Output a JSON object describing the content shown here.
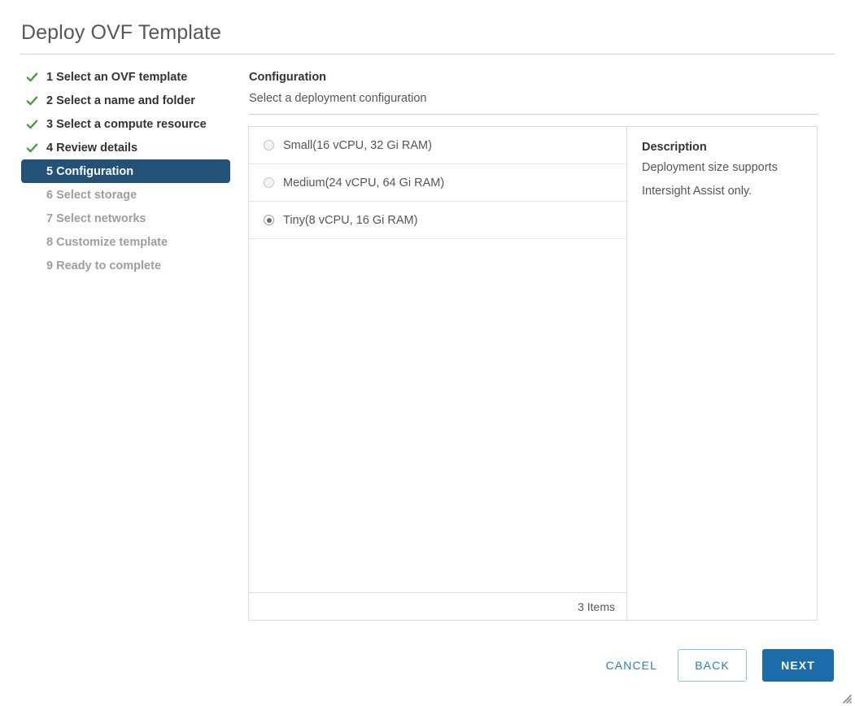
{
  "window": {
    "title": "Deploy OVF Template"
  },
  "steps": [
    {
      "label": "1 Select an OVF template",
      "state": "completed"
    },
    {
      "label": "2 Select a name and folder",
      "state": "completed"
    },
    {
      "label": "3 Select a compute resource",
      "state": "completed"
    },
    {
      "label": "4 Review details",
      "state": "completed"
    },
    {
      "label": "5 Configuration",
      "state": "active"
    },
    {
      "label": "6 Select storage",
      "state": "pending"
    },
    {
      "label": "7 Select networks",
      "state": "pending"
    },
    {
      "label": "8 Customize template",
      "state": "pending"
    },
    {
      "label": "9 Ready to complete",
      "state": "pending"
    }
  ],
  "content": {
    "title": "Configuration",
    "subtitle": "Select a deployment configuration"
  },
  "options": [
    {
      "label": "Small(16 vCPU, 32 Gi RAM)",
      "selected": false
    },
    {
      "label": "Medium(24 vCPU, 64 Gi RAM)",
      "selected": false
    },
    {
      "label": "Tiny(8 vCPU, 16 Gi RAM)",
      "selected": true
    }
  ],
  "options_footer": {
    "item_count": "3 Items"
  },
  "description": {
    "title": "Description",
    "line1": "Deployment size supports",
    "line2": "Intersight Assist only."
  },
  "buttons": {
    "cancel": "CANCEL",
    "back": "BACK",
    "next": "NEXT"
  },
  "colors": {
    "active_step_bg": "#245178",
    "check_green": "#3f9c35",
    "link_blue": "#2d7fb8",
    "next_blue": "#1b6ca8",
    "panel_border": "#dcdcdc"
  }
}
